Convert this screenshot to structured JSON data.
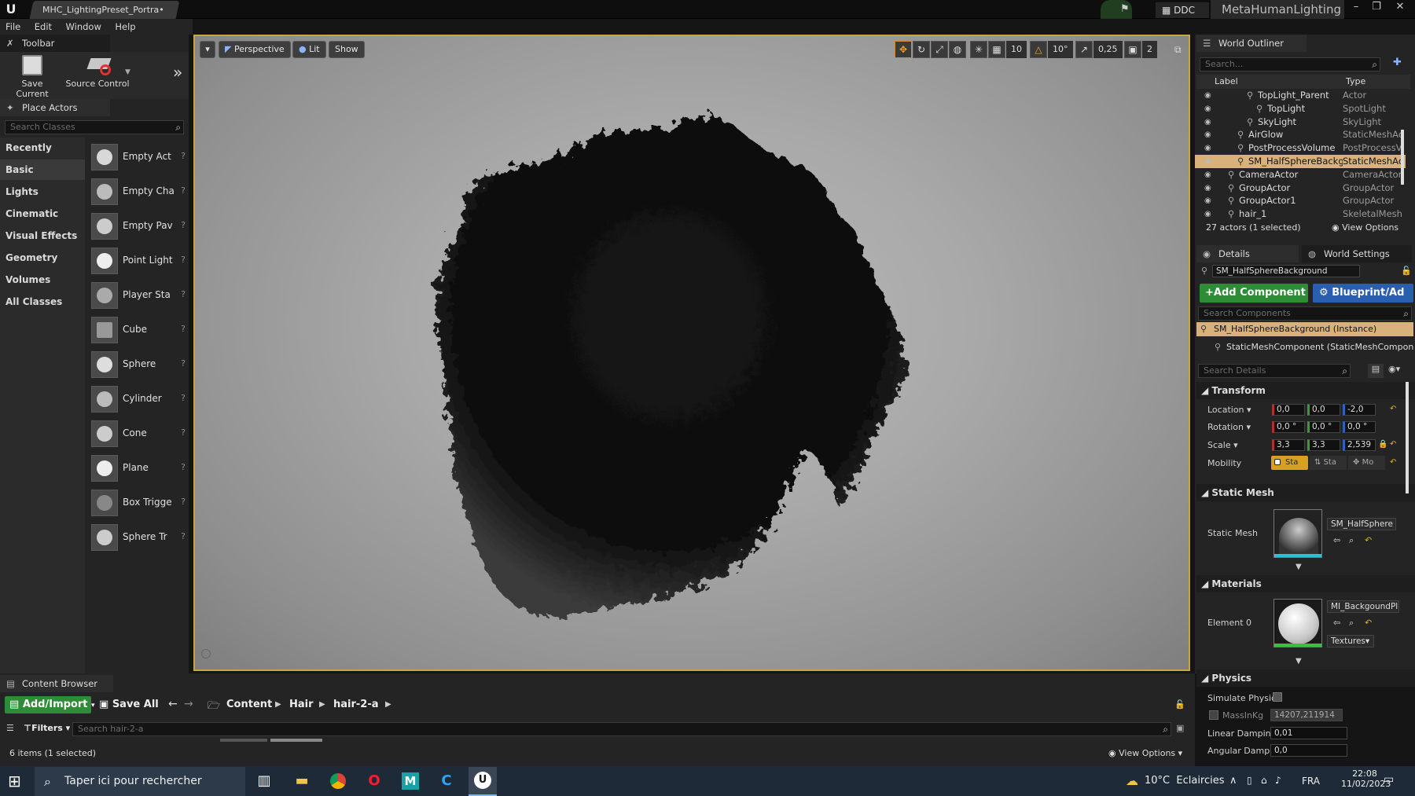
{
  "window": {
    "doc_tab": "MHC_LightingPreset_Portra•",
    "ddc_label": "DDC",
    "project_name": "MetaHumanLighting",
    "min": "–",
    "max": "❐",
    "close": "✕"
  },
  "menu": [
    "File",
    "Edit",
    "Window",
    "Help"
  ],
  "toolbar": {
    "tab_label": "Toolbar",
    "save_current": "Save Current",
    "source_control": "Source Control",
    "expand": "»"
  },
  "place_actors": {
    "tab_label": "Place Actors",
    "search_placeholder": "Search Classes",
    "categories": [
      "Recently Placed",
      "Basic",
      "Lights",
      "Cinematic",
      "Visual Effects",
      "Geometry",
      "Volumes",
      "All Classes"
    ],
    "active_category": "Basic",
    "actors": [
      "Empty Act",
      "Empty Cha",
      "Empty Pav",
      "Point Light",
      "Player Sta",
      "Cube",
      "Sphere",
      "Cylinder",
      "Cone",
      "Plane",
      "Box Trigge",
      "Sphere Tr"
    ]
  },
  "viewport": {
    "perspective": "Perspective",
    "lit": "Lit",
    "show": "Show",
    "grid_snap": "10",
    "rot_snap": "10°",
    "scale_snap": "0,25",
    "camera_speed": "2"
  },
  "outliner": {
    "tab_label": "World Outliner",
    "search_placeholder": "Search...",
    "col_label": "Label",
    "col_type": "Type",
    "rows": [
      {
        "name": "TopLight_Parent",
        "type": "Actor",
        "indent": 3
      },
      {
        "name": "TopLight",
        "type": "SpotLight",
        "indent": 4
      },
      {
        "name": "SkyLight",
        "type": "SkyLight",
        "indent": 3
      },
      {
        "name": "AirGlow",
        "type": "StaticMeshAc",
        "indent": 2
      },
      {
        "name": "PostProcessVolume",
        "type": "PostProcessV",
        "indent": 2
      },
      {
        "name": "SM_HalfSphereBackg",
        "type": "StaticMeshAc",
        "indent": 2,
        "selected": true
      },
      {
        "name": "CameraActor",
        "type": "CameraActor",
        "indent": 1
      },
      {
        "name": "GroupActor",
        "type": "GroupActor",
        "indent": 1
      },
      {
        "name": "GroupActor1",
        "type": "GroupActor",
        "indent": 1
      },
      {
        "name": "hair_1",
        "type": "SkeletalMesh",
        "indent": 1
      }
    ],
    "status": "27 actors (1 selected)",
    "view_options": "View Options"
  },
  "details": {
    "tab_label": "Details",
    "world_settings_tab": "World Settings",
    "object_name": "SM_HalfSphereBackground",
    "add_component": "+Add Component",
    "blueprint": "Blueprint/Ad",
    "search_components": "Search Components",
    "instance_row": "SM_HalfSphereBackground (Instance)",
    "component_row": "StaticMeshComponent (StaticMeshComponent",
    "search_details": "Search Details",
    "transform": {
      "header": "Transform",
      "location_label": "Location",
      "location": [
        "0,0",
        "0,0",
        "-2,0"
      ],
      "rotation_label": "Rotation",
      "rotation": [
        "0,0 °",
        "0,0 °",
        "0,0 °"
      ],
      "scale_label": "Scale",
      "scale": [
        "3,3",
        "3,3",
        "2,539"
      ],
      "mobility_label": "Mobility",
      "mobility": [
        "Sta",
        "Sta",
        "Mo"
      ]
    },
    "static_mesh": {
      "header": "Static Mesh",
      "label": "Static Mesh",
      "value": "SM_HalfSphere"
    },
    "materials": {
      "header": "Materials",
      "element_label": "Element 0",
      "value": "MI_BackgoundPl",
      "textures": "Textures"
    },
    "physics": {
      "header": "Physics",
      "simulate": "Simulate Physic",
      "mass_label": "MassInKg",
      "mass_value": "14207,211914",
      "linear_label": "Linear Damping",
      "linear_value": "0,01",
      "angular_label": "Angular Dampin",
      "angular_value": "0,0"
    }
  },
  "content_browser": {
    "tab_label": "Content Browser",
    "add_import": "Add/Import",
    "save_all": "Save All",
    "path": [
      "Content",
      "Hair",
      "hair-2-a"
    ],
    "filters": "Filters",
    "search_placeholder": "Search hair-2-a",
    "status": "6 items (1 selected)",
    "view_options": "View Options"
  },
  "taskbar": {
    "search_placeholder": "Taper ici pour rechercher",
    "weather": "10°C  Eclaircies",
    "lang": "FRA",
    "time": "22:08",
    "date": "11/02/2023"
  }
}
